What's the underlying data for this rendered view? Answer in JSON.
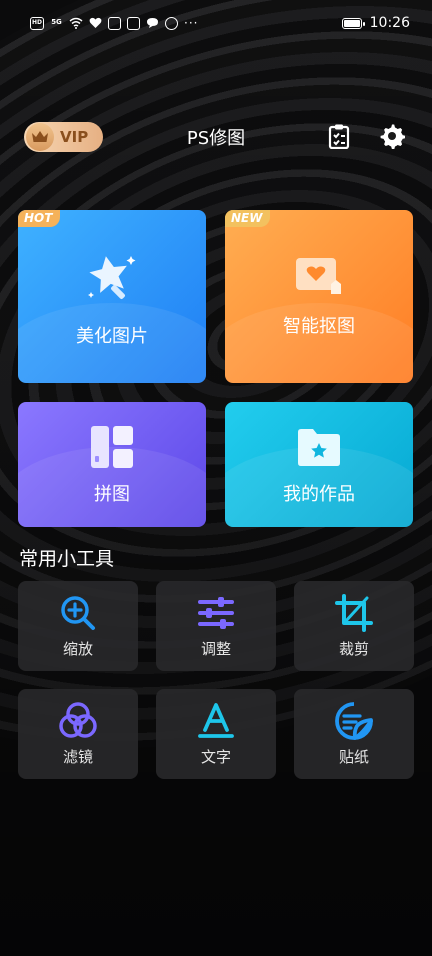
{
  "status_bar": {
    "left_icons": [
      "HD",
      "5G",
      "wifi-icon",
      "heart-icon",
      "robot-icon",
      "cam-icon",
      "chat-icon",
      "shield-icon"
    ],
    "more": "···",
    "time": "10:26"
  },
  "header": {
    "vip_label": "VIP",
    "title": "PS修图"
  },
  "features": [
    {
      "label": "美化图片",
      "tag": "HOT"
    },
    {
      "label": "智能抠图",
      "tag": "NEW"
    },
    {
      "label": "拼图",
      "tag": ""
    },
    {
      "label": "我的作品",
      "tag": ""
    }
  ],
  "tools_section": {
    "title": "常用小工具",
    "items": [
      {
        "label": "缩放",
        "icon": "zoom-in-icon"
      },
      {
        "label": "调整",
        "icon": "sliders-icon"
      },
      {
        "label": "裁剪",
        "icon": "crop-icon"
      },
      {
        "label": "滤镜",
        "icon": "filter-icon"
      },
      {
        "label": "文字",
        "icon": "text-icon"
      },
      {
        "label": "贴纸",
        "icon": "sticker-icon"
      }
    ]
  },
  "colors": {
    "accent_blue": "#2196f3",
    "accent_purple": "#7b68ff",
    "accent_cyan": "#1ec6ea"
  }
}
